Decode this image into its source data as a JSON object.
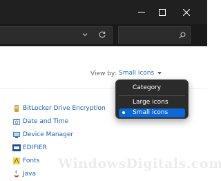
{
  "window": {
    "controls": {
      "minimize_icon": "minimize-icon",
      "maximize_icon": "maximize-icon",
      "close_icon": "close-icon"
    }
  },
  "toolbar": {
    "address_dropdown_icon": "chevron-down-icon",
    "refresh_icon": "refresh-icon",
    "search_icon": "search-icon"
  },
  "view_by": {
    "label": "View by:",
    "value": "Small icons"
  },
  "view_menu": {
    "options": [
      "Category",
      "Large icons",
      "Small icons"
    ],
    "selected": "Small icons"
  },
  "items": [
    {
      "label": "BitLocker Drive Encryption",
      "icon": "bitlocker-icon"
    },
    {
      "label": "Date and Time",
      "icon": "date-time-icon"
    },
    {
      "label": "Device Manager",
      "icon": "device-manager-icon"
    },
    {
      "label": "EDIFIER",
      "icon": "edifier-icon"
    },
    {
      "label": "Fonts",
      "icon": "fonts-icon"
    },
    {
      "label": "Java",
      "icon": "java-icon"
    }
  ],
  "watermark": "WindowsDigitals.com",
  "colors": {
    "titlebar": "#202020",
    "menu_bg": "#2b2b2b",
    "menu_selected": "#0b68d6",
    "link": "#1a5fb4"
  }
}
